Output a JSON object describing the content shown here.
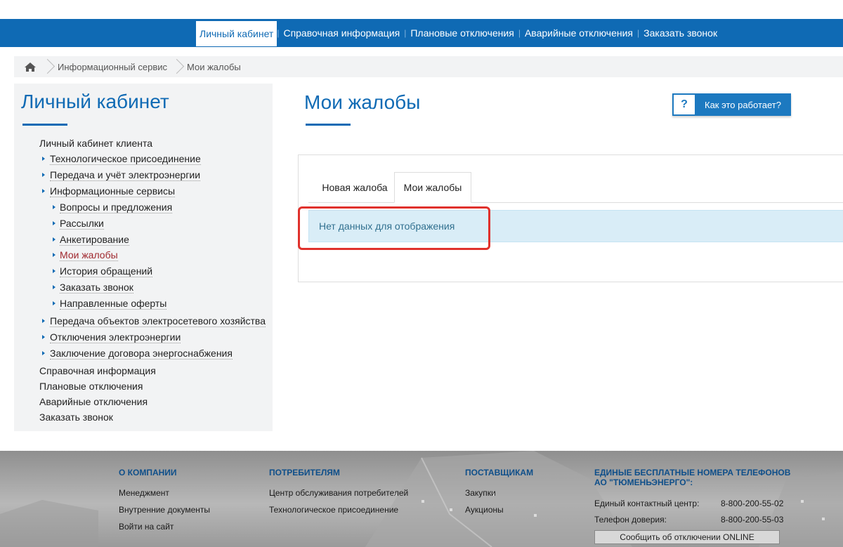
{
  "topnav": {
    "items": [
      {
        "label": "Личный кабинет"
      },
      {
        "label": "Справочная информация"
      },
      {
        "label": "Плановые отключения"
      },
      {
        "label": "Аварийные отключения"
      },
      {
        "label": "Заказать звонок"
      }
    ]
  },
  "breadcrumb": {
    "items": [
      "Информационный сервис",
      "Мои жалобы"
    ]
  },
  "sidebar": {
    "title": "Личный кабинет",
    "items": [
      {
        "label": "Личный кабинет клиента"
      },
      {
        "label": "Технологическое присоединение"
      },
      {
        "label": "Передача и учёт электроэнергии"
      },
      {
        "label": "Информационные сервисы"
      },
      {
        "label": "Вопросы и предложения"
      },
      {
        "label": "Рассылки"
      },
      {
        "label": "Анкетирование"
      },
      {
        "label": "Мои жалобы"
      },
      {
        "label": "История обращений"
      },
      {
        "label": "Заказать звонок"
      },
      {
        "label": "Направленные оферты"
      },
      {
        "label": "Передача объектов электросетевого хозяйства"
      },
      {
        "label": "Отключения электроэнергии"
      },
      {
        "label": "Заключение договора энергоснабжения"
      },
      {
        "label": "Справочная информация"
      },
      {
        "label": "Плановые отключения"
      },
      {
        "label": "Аварийные отключения"
      },
      {
        "label": "Заказать звонок"
      }
    ]
  },
  "main": {
    "title": "Мои жалобы",
    "help_button": {
      "icon_label": "?",
      "label": "Как это работает?"
    },
    "tabs": [
      {
        "label": "Новая жалоба"
      },
      {
        "label": "Мои жалобы"
      }
    ],
    "empty_message": "Нет данных для отображения",
    "highlight_color": "#e0312c"
  },
  "footer": {
    "company": {
      "title": "О КОМПАНИИ",
      "links": [
        "Менеджмент",
        "Внутренние документы",
        "Войти на сайт"
      ]
    },
    "consumers": {
      "title": "ПОТРЕБИТЕЛЯМ",
      "links": [
        "Центр обслуживания потребителей",
        "Технологическое присоединение"
      ]
    },
    "suppliers": {
      "title": "ПОСТАВЩИКАМ",
      "links": [
        "Закупки",
        "Аукционы"
      ]
    },
    "phones": {
      "title_line1": "ЕДИНЫЕ БЕСПЛАТНЫЕ НОМЕРА ТЕЛЕФОНОВ",
      "title_line2": "АО \"ТЮМЕНЬЭНЕРГО\":",
      "rows": [
        {
          "label": "Единый контактный центр:",
          "value": "8-800-200-55-02"
        },
        {
          "label": "Телефон доверия:",
          "value": "8-800-200-55-03"
        }
      ],
      "online_button": "Сообщить об отключении ONLINE"
    }
  },
  "colors": {
    "brand": "#0f6ab4",
    "active_link": "#a0282e",
    "info_bg": "#d9edf7"
  }
}
